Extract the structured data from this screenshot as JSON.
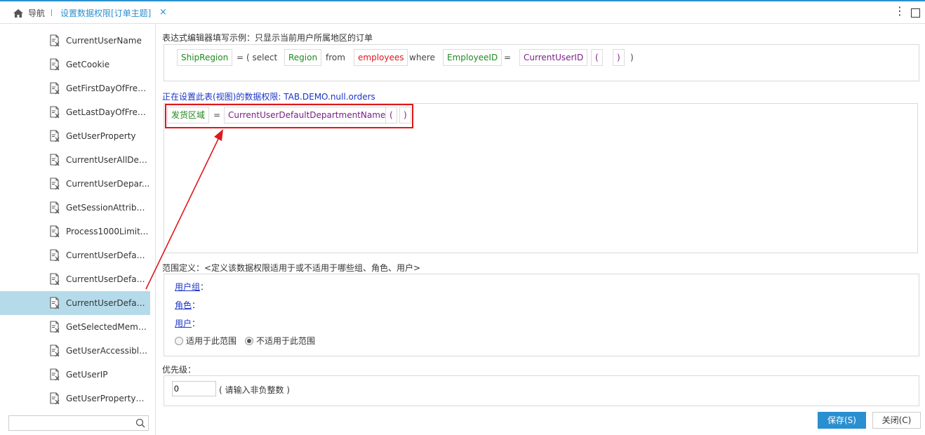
{
  "topbar": {
    "home_label": "导航",
    "tab_title": "设置数据权限[订单主题]",
    "tab_close": "×",
    "menu_glyph": "⋮"
  },
  "sidebar": {
    "items": [
      {
        "label": "CurrentUserName",
        "selected": false
      },
      {
        "label": "GetCookie",
        "selected": false
      },
      {
        "label": "GetFirstDayOfFreq...",
        "selected": false
      },
      {
        "label": "GetLastDayOfFreq...",
        "selected": false
      },
      {
        "label": "GetUserProperty",
        "selected": false
      },
      {
        "label": "CurrentUserAllDep...",
        "selected": false
      },
      {
        "label": "CurrentUserDepar...",
        "selected": false
      },
      {
        "label": "GetSessionAttribute",
        "selected": false
      },
      {
        "label": "Process1000Limit...",
        "selected": false
      },
      {
        "label": "CurrentUserDefaul...",
        "selected": false
      },
      {
        "label": "CurrentUserDefaul...",
        "selected": false
      },
      {
        "label": "CurrentUserDefaul...",
        "selected": true
      },
      {
        "label": "GetSelectedMemb...",
        "selected": false
      },
      {
        "label": "GetUserAccessible...",
        "selected": false
      },
      {
        "label": "GetUserIP",
        "selected": false
      },
      {
        "label": "GetUserPropertyW...",
        "selected": false
      }
    ],
    "search_value": ""
  },
  "example": {
    "heading": "表达式编辑器填写示例：只显示当前用户所属地区的订单",
    "tokens": {
      "shipregion": "ShipRegion",
      "eq1": "=",
      "lparen_select": "( select",
      "region": "Region",
      "from": "from",
      "employees": "employees",
      "where": "where",
      "employeeid": "EmployeeID",
      "eq2": "=",
      "currentuserid": "CurrentUserID",
      "lp": "(",
      "rp": ")",
      "close": ")"
    }
  },
  "editor": {
    "heading": "正在设置此表(视图)的数据权限: TAB.DEMO.null.orders",
    "tokens": {
      "field": "发货区域",
      "eq": "=",
      "func": "CurrentUserDefaultDepartmentName",
      "lp": "(",
      "rp": ")"
    }
  },
  "scope": {
    "heading": "范围定义：<定义该数据权限适用于或不适用于哪些组、角色、用户>",
    "user_group": "用户组",
    "role": "角色",
    "user": "用户",
    "colon": "：",
    "apply_label": "适用于此范围",
    "not_apply_label": "不适用于此范围",
    "selected": "not_apply"
  },
  "priority": {
    "heading": "优先级：",
    "value": "0",
    "hint": "( 请输入非负整数 )"
  },
  "buttons": {
    "save": "保存(S)",
    "close": "关闭(C)"
  },
  "colors": {
    "accent": "#2a8fd0",
    "highlight_red": "#e0171b",
    "field_green": "#1f8a1f",
    "func_purple": "#7a1f86",
    "selected_row": "#b5dbea"
  }
}
